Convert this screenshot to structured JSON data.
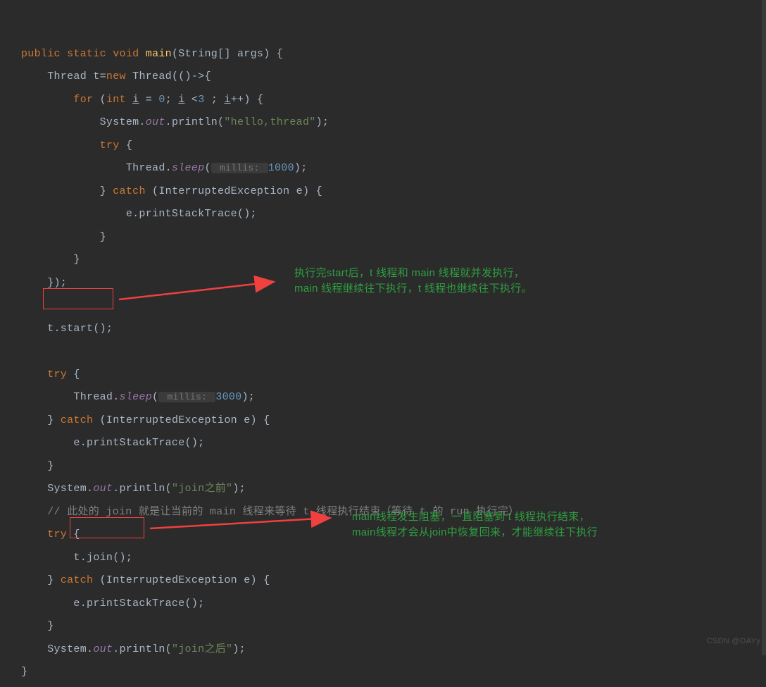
{
  "code": {
    "l1a": "public ",
    "l1b": "static ",
    "l1c": "void ",
    "l1d": "main",
    "l1e": "(String[] args) {",
    "l2a": "    Thread t=",
    "l2b": "new ",
    "l2c": "Thread(()->{",
    "l3a": "        for ",
    "l3b": "(",
    "l3c": "int ",
    "l3d": "i",
    "l3e": " = ",
    "l3f": "0",
    "l3g": "; ",
    "l3h": "i",
    "l3i": " <",
    "l3j": "3",
    "l3k": " ; ",
    "l3l": "i",
    "l3m": "++) {",
    "l4a": "            System.",
    "l4b": "out",
    "l4c": ".println(",
    "l4d": "\"hello,thread\"",
    "l4e": ");",
    "l5a": "            try ",
    "l5b": "{",
    "l6a": "                Thread.",
    "l6b": "sleep",
    "l6c": "(",
    "l6hint": " millis: ",
    "l6d": "1000",
    "l6e": ");",
    "l7a": "            } ",
    "l7b": "catch ",
    "l7c": "(InterruptedException e) {",
    "l8a": "                e.printStackTrace();",
    "l9a": "            }",
    "l10a": "        }",
    "l11a": "    });",
    "l12a": "",
    "l13a": "    t.start();",
    "l14a": "",
    "l15a": "    try ",
    "l15b": "{",
    "l16a": "        Thread.",
    "l16b": "sleep",
    "l16c": "(",
    "l16hint": " millis: ",
    "l16d": "3000",
    "l16e": ");",
    "l17a": "    } ",
    "l17b": "catch ",
    "l17c": "(InterruptedException e) {",
    "l18a": "        e.printStackTrace();",
    "l19a": "    }",
    "l20a": "    System.",
    "l20b": "out",
    "l20c": ".println(",
    "l20d": "\"join之前\"",
    "l20e": ");",
    "l21a": "    // 此处的 join 就是让当前的 main 线程来等待 t 线程执行结束（等待 t 的 run 执行完）",
    "l22a": "    try ",
    "l22b": "{",
    "l23a": "        t.join();",
    "l24a": "    } ",
    "l24b": "catch ",
    "l24c": "(InterruptedException e) {",
    "l25a": "        e.printStackTrace();",
    "l26a": "    }",
    "l27a": "    System.",
    "l27b": "out",
    "l27c": ".println(",
    "l27d": "\"join之后\"",
    "l27e": ");",
    "l28a": "}"
  },
  "annotations": {
    "a1_line1": "执行完start后，t 线程和 main 线程就并发执行，",
    "a1_line2": "main 线程继续往下执行，t 线程也继续往下执行。",
    "a2_line1": "main线程发生阻塞，一直阻塞到 t 线程执行结束，",
    "a2_line2": "main线程才会从join中恢复回来，才能继续往下执行"
  },
  "watermark": "CSDN @OAYy"
}
